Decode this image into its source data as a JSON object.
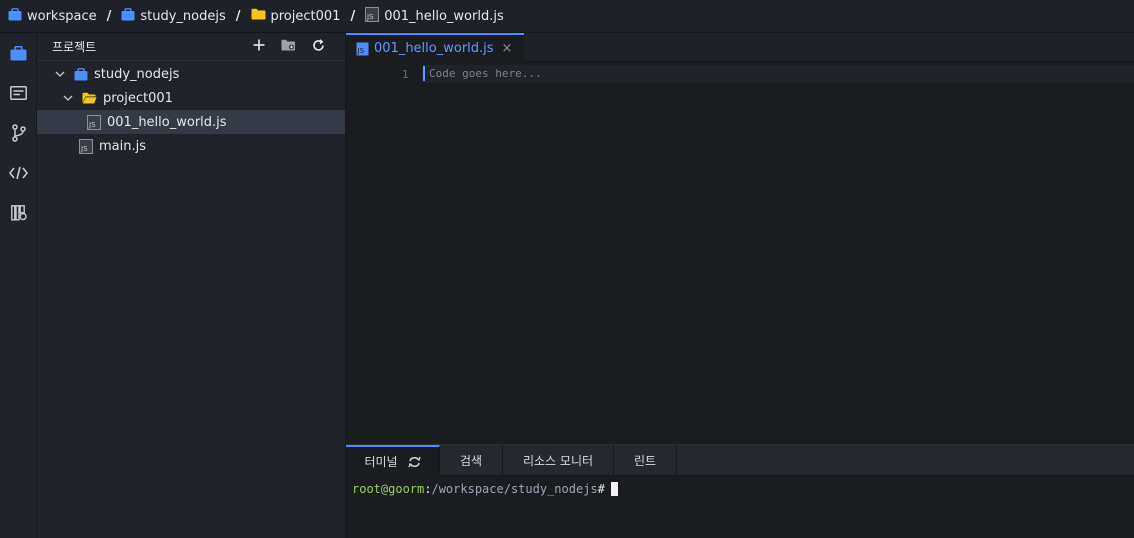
{
  "breadcrumb": {
    "items": [
      {
        "label": "workspace",
        "icon": "workspace-icon"
      },
      {
        "label": "study_nodejs",
        "icon": "workspace-icon"
      },
      {
        "label": "project001",
        "icon": "folder-icon"
      },
      {
        "label": "001_hello_world.js",
        "icon": "js-file-icon"
      }
    ],
    "separator": "/"
  },
  "activity_bar": [
    "project-icon",
    "files-icon",
    "git-icon",
    "code-icon",
    "package-icon"
  ],
  "sidebar": {
    "title": "프로젝트",
    "actions": [
      "add-icon",
      "new-folder-icon",
      "refresh-icon"
    ],
    "tree": [
      {
        "label": "study_nodejs",
        "type": "project",
        "expanded": true
      },
      {
        "label": "project001",
        "type": "folder",
        "expanded": true
      },
      {
        "label": "001_hello_world.js",
        "type": "js-file",
        "selected": true
      },
      {
        "label": "main.js",
        "type": "js-file"
      }
    ]
  },
  "editor": {
    "tab": {
      "label": "001_hello_world.js",
      "close": "×"
    },
    "line_number": "1",
    "placeholder": "Code goes here..."
  },
  "panel": {
    "tabs": [
      {
        "label": "터미널",
        "active": true
      },
      {
        "label": "검색"
      },
      {
        "label": "리소스 모니터"
      },
      {
        "label": "린트"
      }
    ],
    "terminal": {
      "user": "root@goorm",
      "colon": ":",
      "path": "/workspace/study_nodejs",
      "prompt": "#"
    }
  },
  "colors": {
    "accent": "#4c8dff",
    "folder": "#f5c518",
    "terminal_user": "#9bd35a"
  }
}
